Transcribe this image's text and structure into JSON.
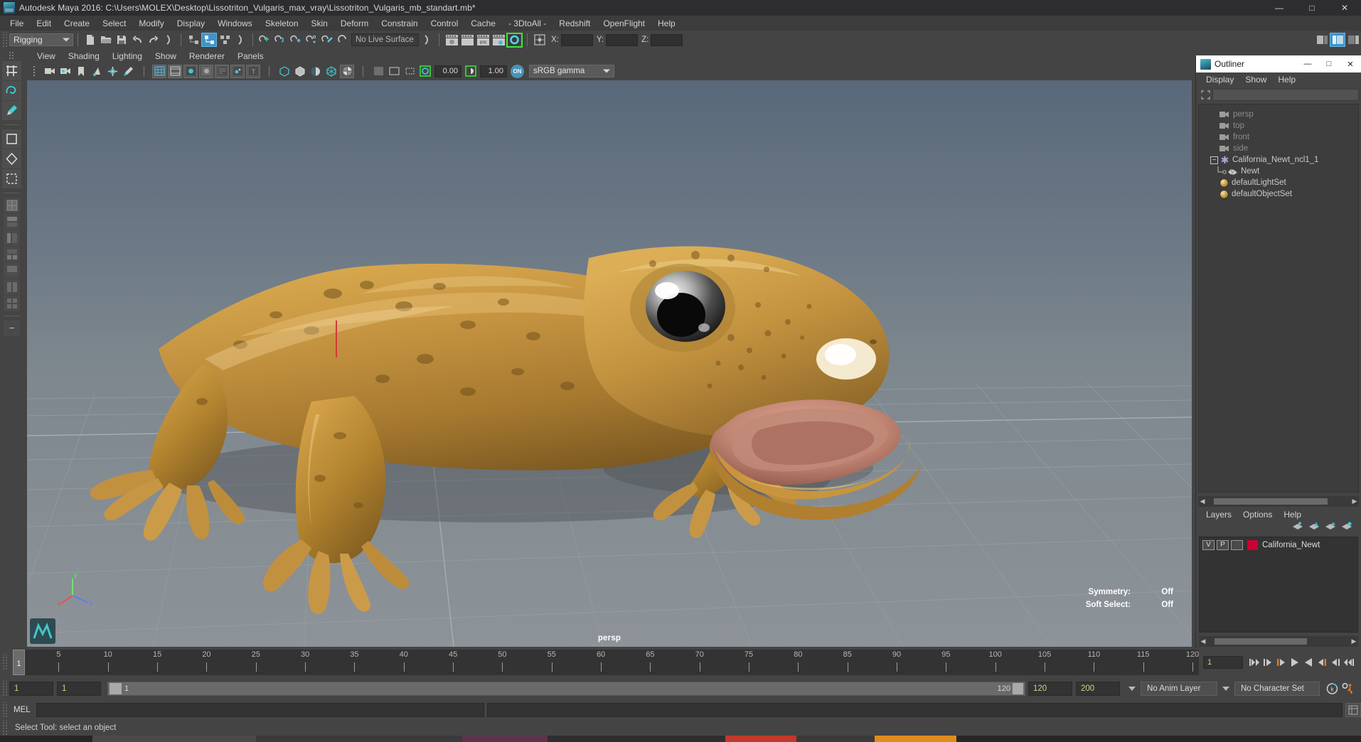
{
  "window": {
    "title": "Autodesk Maya 2016: C:\\Users\\MOLEX\\Desktop\\Lissotriton_Vulgaris_max_vray\\Lissotriton_Vulgaris_mb_standart.mb*",
    "icon": "maya-icon",
    "minimize": "—",
    "maximize": "□",
    "close": "✕"
  },
  "menubar": {
    "items": [
      "File",
      "Edit",
      "Create",
      "Select",
      "Modify",
      "Display",
      "Windows",
      "Skeleton",
      "Skin",
      "Deform",
      "Constrain",
      "Control",
      "Cache",
      "- 3DtoAll -",
      "Redshift",
      "OpenFlight",
      "Help"
    ]
  },
  "statusline": {
    "mode": "Rigging",
    "live_surface": "No Live Surface",
    "coord_x_label": "X:",
    "coord_y_label": "Y:",
    "coord_z_label": "Z:",
    "coord_x_value": "",
    "coord_y_value": "",
    "coord_z_value": "",
    "ipr_label": "IPR"
  },
  "viewport_panel": {
    "menus": [
      "View",
      "Shading",
      "Lighting",
      "Show",
      "Renderer",
      "Panels"
    ],
    "exposure_value": "0.00",
    "gamma_value": "1.00",
    "on_badge": "ON",
    "color_management": "sRGB gamma",
    "camera_label": "persp",
    "hud": [
      {
        "label": "Symmetry:",
        "value": "Off"
      },
      {
        "label": "Soft Select:",
        "value": "Off"
      }
    ],
    "axis": {
      "x": "x",
      "y": "y",
      "z": "z"
    }
  },
  "outliner": {
    "title": "Outliner",
    "minimize": "—",
    "maximize": "□",
    "close": "✕",
    "menus": [
      "Display",
      "Show",
      "Help"
    ],
    "search_value": "",
    "items": [
      {
        "label": "persp",
        "icon": "camera-icon",
        "dim": true,
        "indent": 0,
        "type": "camera"
      },
      {
        "label": "top",
        "icon": "camera-icon",
        "dim": true,
        "indent": 0,
        "type": "camera"
      },
      {
        "label": "front",
        "icon": "camera-icon",
        "dim": true,
        "indent": 0,
        "type": "camera"
      },
      {
        "label": "side",
        "icon": "camera-icon",
        "dim": true,
        "indent": 0,
        "type": "camera"
      },
      {
        "label": "California_Newt_ncl1_1",
        "icon": "star-icon",
        "dim": false,
        "indent": 0,
        "type": "group",
        "expanded": true
      },
      {
        "label": "Newt",
        "icon": "mesh-icon",
        "dim": false,
        "indent": 1,
        "type": "mesh"
      },
      {
        "label": "defaultLightSet",
        "icon": "set-icon",
        "dim": false,
        "indent": 0,
        "type": "set"
      },
      {
        "label": "defaultObjectSet",
        "icon": "set-icon",
        "dim": false,
        "indent": 0,
        "type": "set"
      }
    ]
  },
  "layer_editor": {
    "menus": [
      "Layers",
      "Options",
      "Help"
    ],
    "columns": [
      "V",
      "P"
    ],
    "layers": [
      {
        "visible": "V",
        "playback": "P",
        "state": "",
        "color": "#cc0033",
        "name": "California_Newt"
      }
    ]
  },
  "time_slider": {
    "current_frame": "1",
    "current_frame_field": "1",
    "ticks": [
      5,
      10,
      15,
      20,
      25,
      30,
      35,
      40,
      45,
      50,
      55,
      60,
      65,
      70,
      75,
      80,
      85,
      90,
      95,
      100,
      105,
      110,
      115,
      120
    ],
    "start": 1,
    "end": 120,
    "playback_buttons": [
      "go-to-start",
      "step-back-keyframe",
      "step-back-frame",
      "play-backwards",
      "play-forwards",
      "step-forward-frame",
      "step-forward-keyframe",
      "go-to-end"
    ]
  },
  "range_slider": {
    "anim_start": "1",
    "range_start": "1",
    "bar_start_label": "1",
    "bar_end_label": "120",
    "range_end": "120",
    "anim_end": "200",
    "anim_layer": "No Anim Layer",
    "character_set": "No Character Set"
  },
  "command_line": {
    "language": "MEL",
    "input_value": "",
    "output_value": ""
  },
  "help_line": {
    "text": "Select Tool: select an object"
  },
  "colors": {
    "accent": "#5285a6",
    "layer_swatch": "#cc0033",
    "highlight_green": "#39e639",
    "field_text": "#d2cf8a",
    "playhead": "#e07b22"
  }
}
